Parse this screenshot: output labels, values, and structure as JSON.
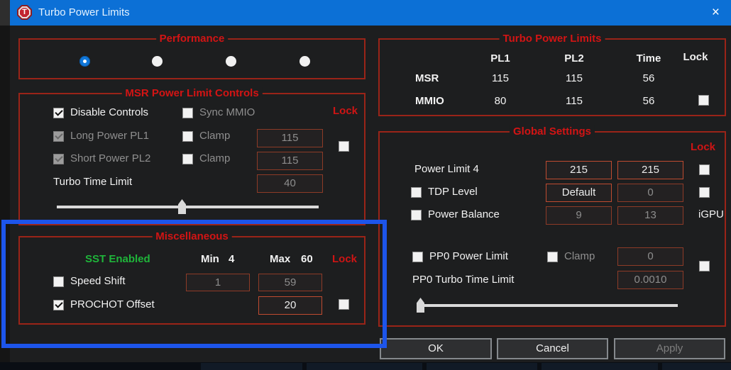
{
  "window": {
    "title": "Turbo Power Limits",
    "close_glyph": "×",
    "icon_letter": "T"
  },
  "palette": {
    "titlebar_blue": "#0c70d6",
    "group_title_red": "#d31414",
    "group_border_red": "#9a2418",
    "green": "#1fb53a",
    "highlight_blue": "#1d55ea"
  },
  "performance": {
    "title": "Performance",
    "radios": [
      {
        "state": "selected"
      },
      {
        "state": ""
      },
      {
        "state": ""
      },
      {
        "state": ""
      }
    ]
  },
  "msr": {
    "title": "MSR Power Limit Controls",
    "lock_label": "Lock",
    "lock_checkbox_state": "",
    "disable_controls": {
      "label": "Disable Controls",
      "state": "checked"
    },
    "sync_mmio": {
      "label": "Sync MMIO",
      "state": ""
    },
    "long_power_pl1": {
      "label": "Long Power PL1",
      "state": "checked disabled"
    },
    "clamp_pl1": {
      "label": "Clamp",
      "state": ""
    },
    "pl1_field": {
      "value": "115",
      "state": "dis"
    },
    "short_power_pl2": {
      "label": "Short Power PL2",
      "state": "checked disabled"
    },
    "clamp_pl2": {
      "label": "Clamp",
      "state": ""
    },
    "pl2_field": {
      "value": "115",
      "state": "dis"
    },
    "turbo_time_limit_label": "Turbo Time Limit",
    "turbo_time_field": {
      "value": "40",
      "state": "dis"
    },
    "slider": {
      "thumb_pos_pct": 48
    }
  },
  "misc": {
    "title": "Miscellaneous",
    "sst_label": "SST Enabled",
    "min_label": "Min",
    "min_value": "4",
    "max_label": "Max",
    "max_value": "60",
    "lock_label": "Lock",
    "lock_checkbox_state": "",
    "speed_shift": {
      "label": "Speed Shift",
      "state": ""
    },
    "min_field": {
      "value": "1",
      "state": "dis"
    },
    "max_field": {
      "value": "59",
      "state": "dis"
    },
    "prochot_offset": {
      "label": "PROCHOT Offset",
      "state": "checked"
    },
    "prochot_field": {
      "value": "20",
      "state": ""
    }
  },
  "tpl": {
    "title": "Turbo Power Limits",
    "headers": {
      "pl1": "PL1",
      "pl2": "PL2",
      "time": "Time",
      "lock": "Lock"
    },
    "rows": [
      {
        "label": "MSR",
        "pl1": "115",
        "pl2": "115",
        "time": "56"
      },
      {
        "label": "MMIO",
        "pl1": "80",
        "pl2": "115",
        "time": "56",
        "lock_checkbox_state": ""
      }
    ]
  },
  "gs": {
    "title": "Global Settings",
    "lock_label": "Lock",
    "power_limit_4": {
      "label": "Power Limit 4",
      "field1": {
        "value": "215",
        "state": ""
      },
      "field2": {
        "value": "215",
        "state": ""
      },
      "lock_checkbox_state": ""
    },
    "tdp_level": {
      "label": "TDP Level",
      "state": "",
      "field1": {
        "value": "Default",
        "state": ""
      },
      "field2": {
        "value": "0",
        "state": "dis"
      },
      "lock_checkbox_state": ""
    },
    "power_balance": {
      "label": "Power Balance",
      "state": "",
      "field1": {
        "value": "9",
        "state": "dis"
      },
      "field2": {
        "value": "13",
        "state": "dis"
      },
      "igpu_label": "iGPU"
    },
    "pp0_power_limit": {
      "label": "PP0 Power Limit",
      "state": "",
      "clamp": {
        "label": "Clamp",
        "state": ""
      },
      "field": {
        "value": "0",
        "state": "dis"
      },
      "lock_checkbox_state": ""
    },
    "pp0_turbo_time_limit": {
      "label": "PP0 Turbo Time Limit",
      "field": {
        "value": "0.0010",
        "state": "dis"
      }
    },
    "slider": {
      "thumb_pos_pct": 1
    }
  },
  "buttons": {
    "ok": "OK",
    "cancel": "Cancel",
    "apply": "Apply",
    "apply_state": "disabled"
  },
  "annotation": {
    "type": "highlight-box",
    "target": "miscellaneous-group"
  }
}
